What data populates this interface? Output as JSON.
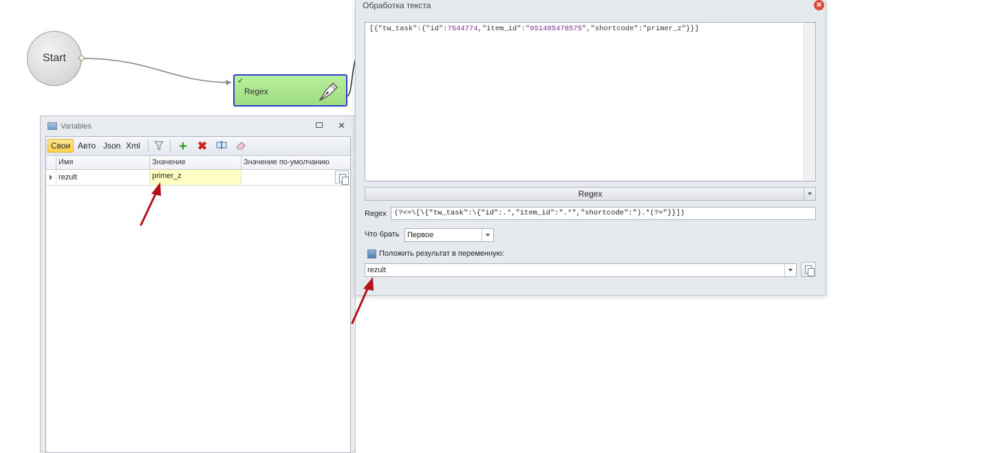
{
  "canvas": {
    "start_label": "Start",
    "regex_node_label": "Regex"
  },
  "variables_panel": {
    "title": "Variables",
    "tabs": [
      {
        "label": "Свои",
        "active": true
      },
      {
        "label": "Авто",
        "active": false
      },
      {
        "label": "Json",
        "active": false
      },
      {
        "label": "Xml",
        "active": false
      }
    ],
    "toolbar_icons": [
      "filter-icon",
      "add-icon",
      "delete-icon",
      "rename-icon",
      "eraser-icon"
    ],
    "columns": [
      "Имя",
      "Значение",
      "Значение по-умолчанию"
    ],
    "rows": [
      {
        "name": "rezult",
        "value": "primer_z",
        "default": ""
      }
    ]
  },
  "dialog": {
    "title": "Обработка текста",
    "input_text_parts": {
      "p1": "[{\"tw_task\":{\"id\":",
      "n1": "7544774",
      "p2": ",\"item_id\":\"",
      "n2": "951485478575",
      "p3": "\",\"shortcode\":\"primer_z\"}}]"
    },
    "mode": "Regex",
    "regex_label": "Regex",
    "regex_value": "(?<=\\[\\{\"tw_task\":\\{\"id\":.*,\"item_id\":\".*\",\"shortcode\":\").*(?=\"}}])",
    "take_label": "Что брать",
    "take_value": "Первое",
    "put_result_label": "Положить результат в переменную:",
    "result_variable": "rezult"
  },
  "colors": {
    "regex_node_fill": "#a9e58a",
    "regex_node_border": "#2c3bd1",
    "highlight_cell": "#ffffc4",
    "arrow_red": "#b3121a",
    "active_tab": "#ffd24d"
  }
}
